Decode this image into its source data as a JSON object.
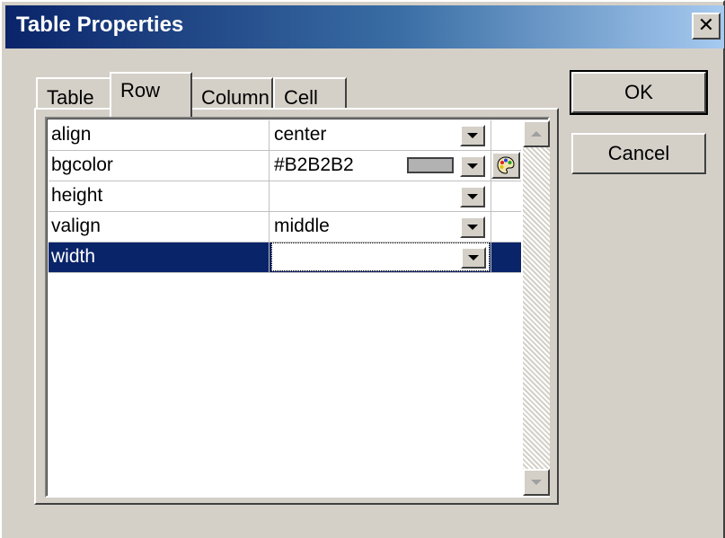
{
  "window": {
    "title": "Table Properties",
    "close_glyph": "✕"
  },
  "tabs": [
    {
      "label": "Table"
    },
    {
      "label": "Row"
    },
    {
      "label": "Column"
    },
    {
      "label": "Cell"
    }
  ],
  "active_tab": "Row",
  "properties": [
    {
      "name": "align",
      "value": "center"
    },
    {
      "name": "bgcolor",
      "value": "#B2B2B2",
      "swatch_color": "#B2B2B2",
      "icon": "palette-icon"
    },
    {
      "name": "height",
      "value": ""
    },
    {
      "name": "valign",
      "value": "middle"
    },
    {
      "name": "width",
      "value": "",
      "selected": true
    }
  ],
  "buttons": {
    "ok_label": "OK",
    "cancel_label": "Cancel"
  },
  "colors": {
    "title_gradient_start": "#0a246a",
    "title_gradient_end": "#a6caf0",
    "dialog_face": "#d4d0c8",
    "selection": "#0a246a"
  }
}
